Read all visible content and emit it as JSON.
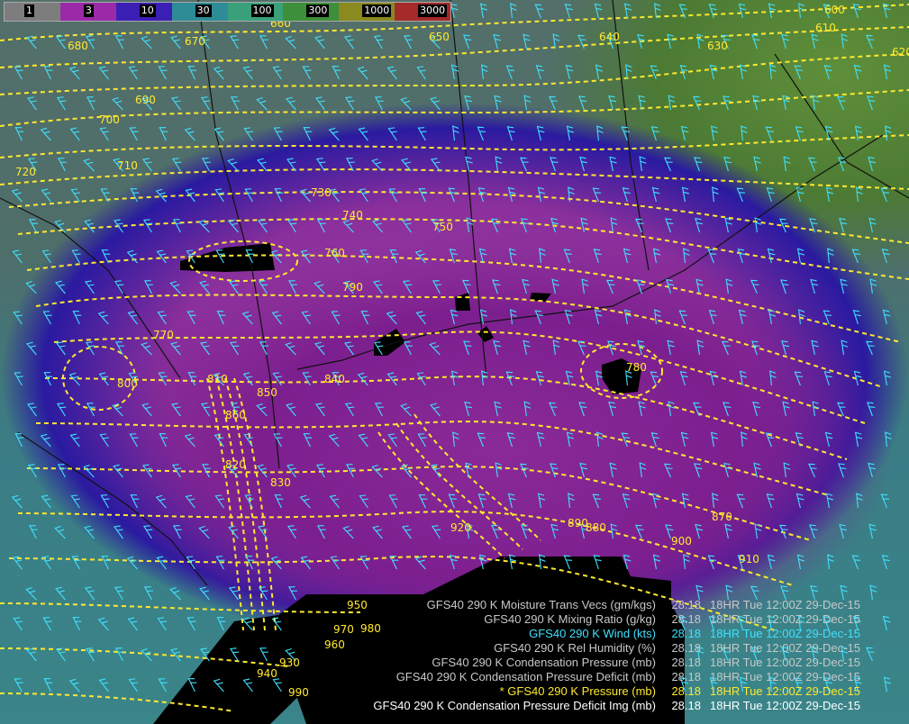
{
  "colorbar": {
    "labels": [
      "1",
      "3",
      "10",
      "30",
      "100",
      "300",
      "1000",
      "3000"
    ],
    "colors": [
      "#7d7d7d",
      "#9a2aa8",
      "#3b1fb5",
      "#2e8c97",
      "#3aa07a",
      "#3e8f3a",
      "#8a8a20",
      "#a52a2a"
    ]
  },
  "contour_labels": [
    "680",
    "670",
    "660",
    "650",
    "640",
    "630",
    "620",
    "610",
    "600",
    "700",
    "690",
    "720",
    "710",
    "730",
    "740",
    "750",
    "760",
    "770",
    "780",
    "790",
    "800",
    "810",
    "820",
    "830",
    "840",
    "850",
    "860",
    "870",
    "880",
    "890",
    "900",
    "910",
    "920",
    "930",
    "940",
    "950",
    "960",
    "970",
    "980",
    "990"
  ],
  "legend": [
    {
      "name": "GFS40 290 K Moisture Trans Vecs  (gm/kgs)",
      "value": "28.18",
      "time": "18HR  Tue 12:00Z 29-Dec-15",
      "color": "#c8c8c8"
    },
    {
      "name": "GFS40 290 K Mixing Ratio  (g/kg)",
      "value": "28.18",
      "time": "18HR  Tue 12:00Z 29-Dec-15",
      "color": "#c8c8c8"
    },
    {
      "name": "GFS40 290 K Wind  (kts)",
      "value": "28.18",
      "time": "18HR  Tue 12:00Z 29-Dec-15",
      "color": "#3fe0ff"
    },
    {
      "name": "GFS40 290 K Rel Humidity  (%)",
      "value": "28.18",
      "time": "18HR  Tue 12:00Z 29-Dec-15",
      "color": "#c8c8c8"
    },
    {
      "name": "GFS40 290 K Condensation Pressure  (mb)",
      "value": "28.18",
      "time": "18HR  Tue 12:00Z 29-Dec-15",
      "color": "#c8c8c8"
    },
    {
      "name": "GFS40 290 K Condensation Pressure Deficit  (mb)",
      "value": "28.18",
      "time": "18HR  Tue 12:00Z 29-Dec-15",
      "color": "#c8c8c8"
    },
    {
      "name": "* GFS40 290 K Pressure  (mb)",
      "value": "28.18",
      "time": "18HR  Tue 12:00Z 29-Dec-15",
      "color": "#ffe830"
    },
    {
      "name": "GFS40 290 K Condensation Pressure Deficit Img (mb)",
      "value": "28.18",
      "time": "18HR  Tue 12:00Z 29-Dec-15",
      "color": "#ffffff"
    }
  ]
}
